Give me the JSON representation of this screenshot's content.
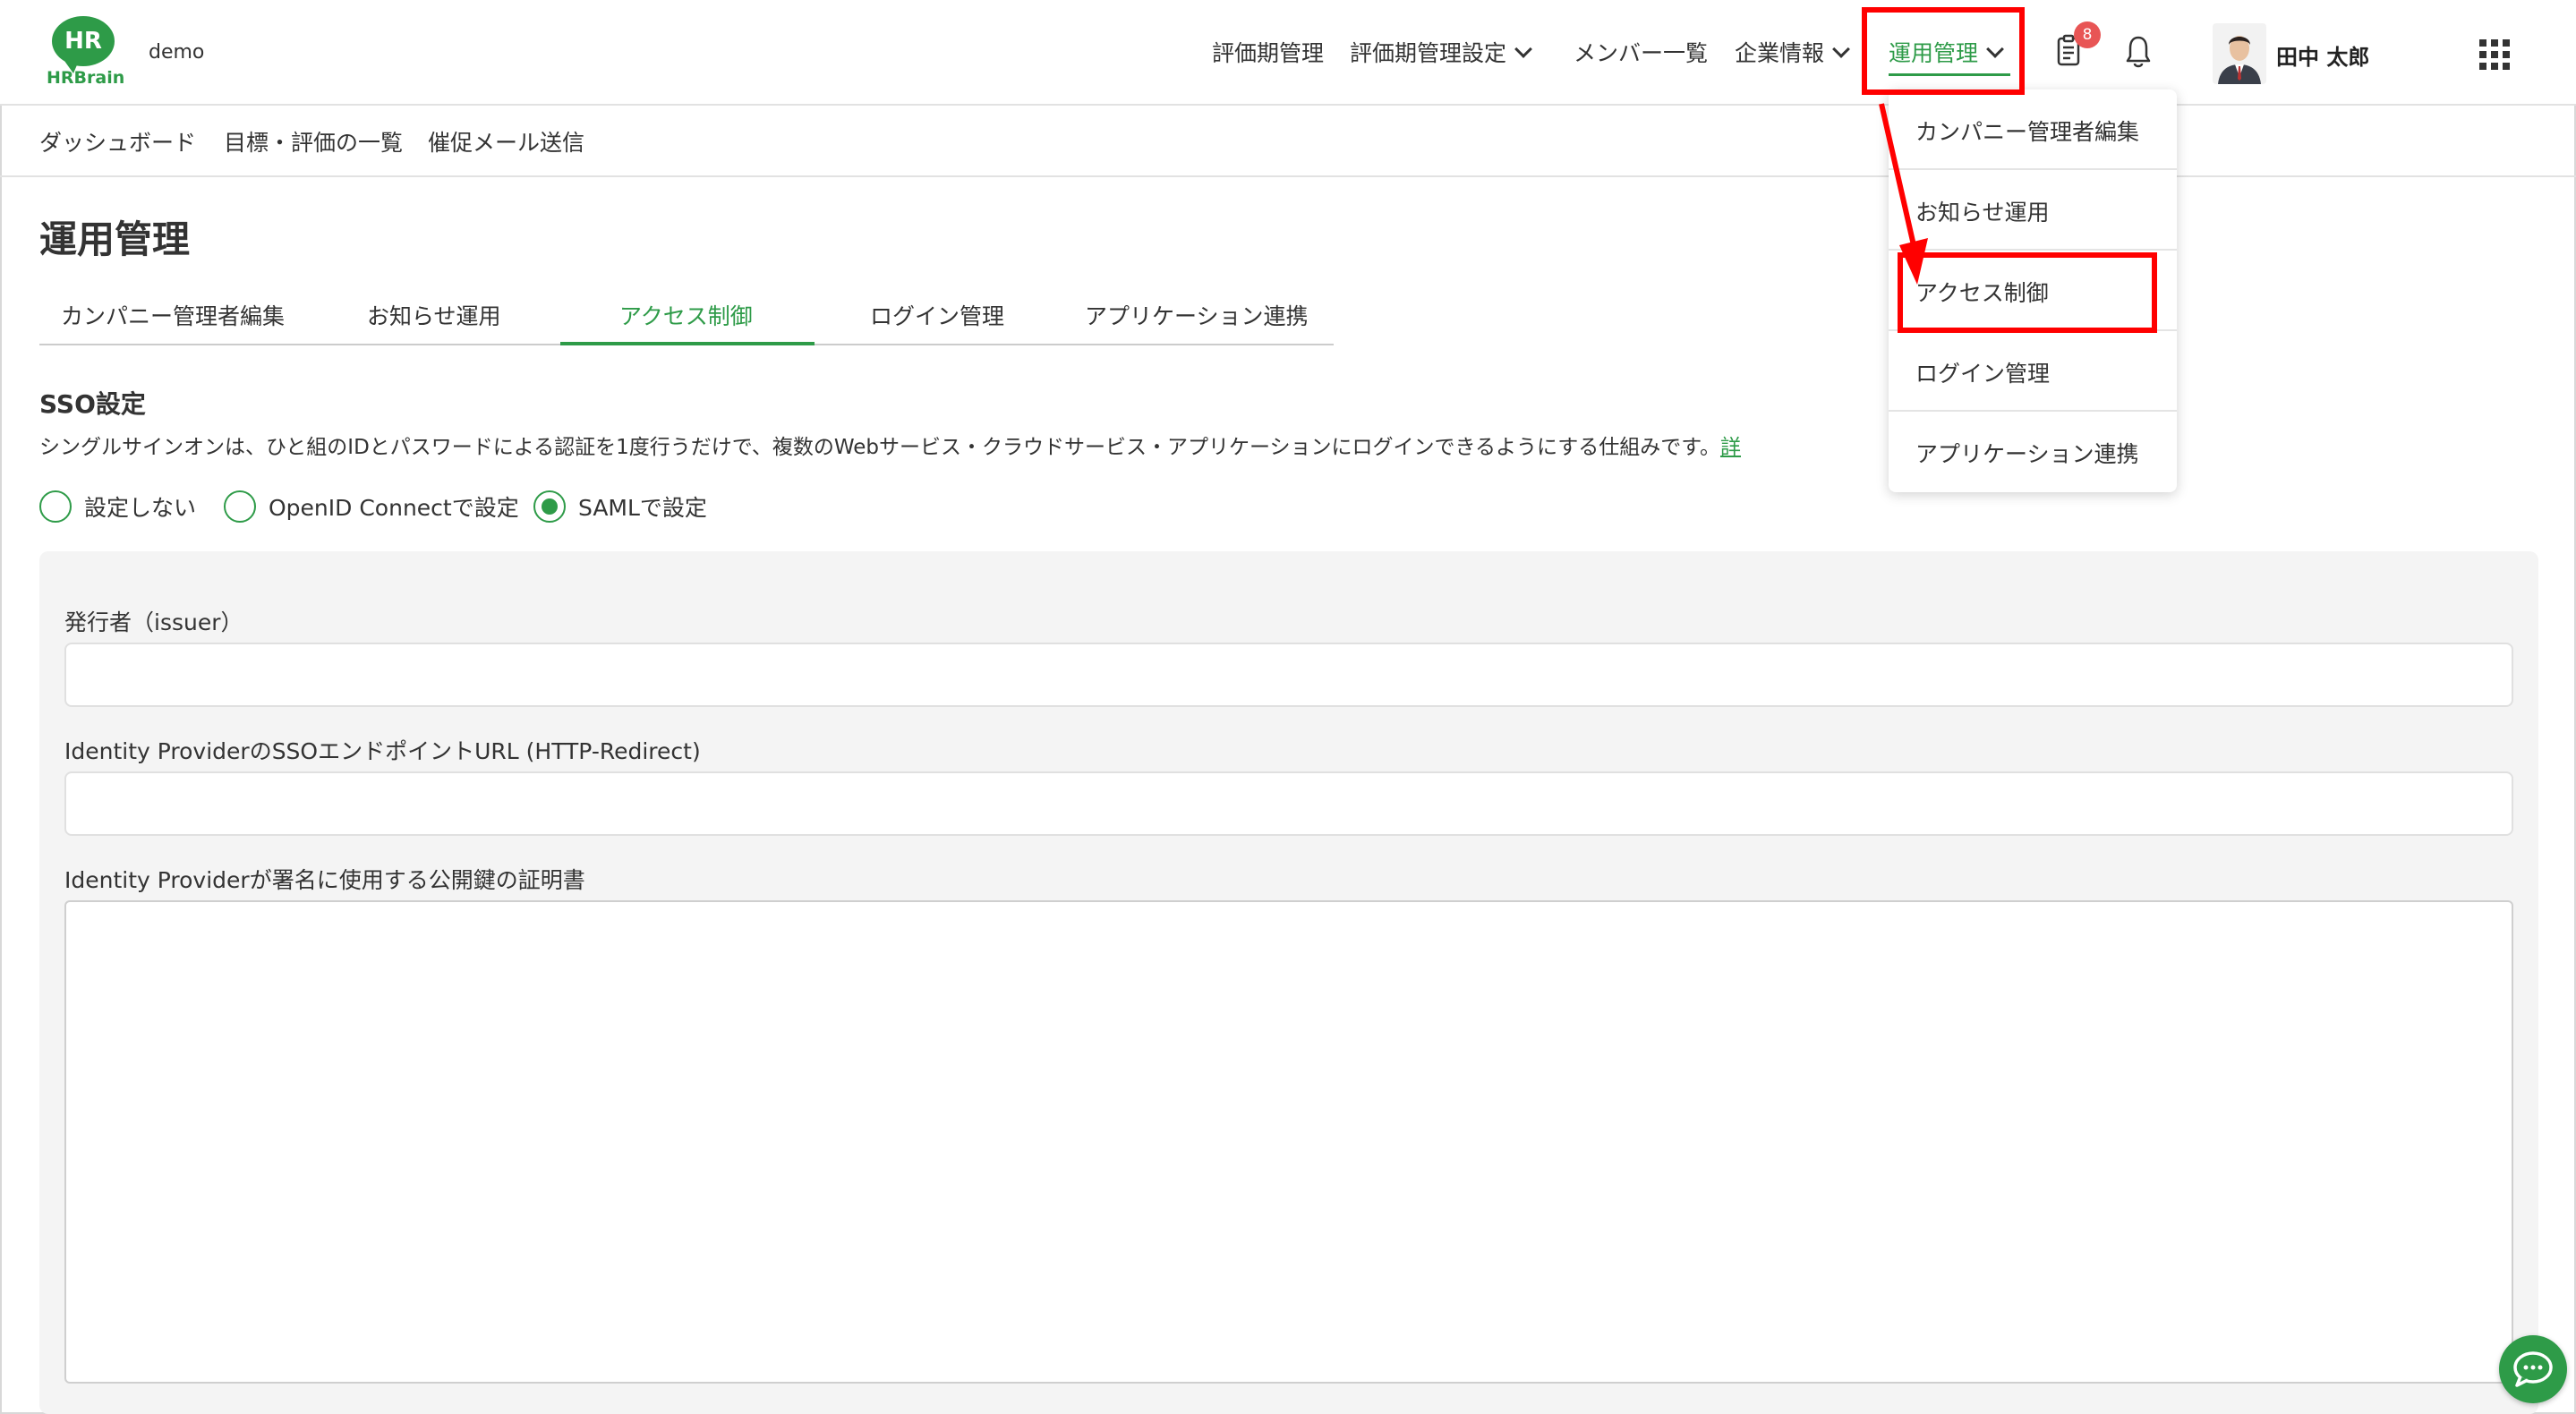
{
  "header": {
    "logo_text": "HR",
    "logo_brand": "HRBrain",
    "tenant": "demo",
    "nav": [
      {
        "label": "評価期管理"
      },
      {
        "label": "評価期管理設定"
      },
      {
        "label": "メンバー一覧"
      },
      {
        "label": "企業情報"
      },
      {
        "label": "運用管理"
      }
    ],
    "notification_count": "8",
    "user_name": "田中 太郎"
  },
  "subnav": {
    "items": [
      "ダッシュボード",
      "目標・評価の一覧",
      "催促メール送信"
    ]
  },
  "page": {
    "title": "運用管理",
    "tabs": [
      "カンパニー管理者編集",
      "お知らせ運用",
      "アクセス制御",
      "ログイン管理",
      "アプリケーション連携"
    ],
    "active_tab": "アクセス制御"
  },
  "sso": {
    "title": "SSO設定",
    "description": "シングルサインオンは、ひと組のIDとパスワードによる認証を1度行うだけで、複数のWebサービス・クラウドサービス・アプリケーションにログインできるようにする仕組みです。",
    "link_text": "詳",
    "options": [
      "設定しない",
      "OpenID Connectで設定",
      "SAMLで設定"
    ],
    "selected": "SAMLで設定",
    "fields": {
      "issuer_label": "発行者（issuer）",
      "issuer_value": "",
      "sso_url_label": "Identity ProviderのSSOエンドポイントURL (HTTP-Redirect)",
      "sso_url_value": "",
      "cert_label": "Identity Providerが署名に使用する公開鍵の証明書",
      "cert_value": ""
    }
  },
  "dropdown": {
    "items": [
      "カンパニー管理者編集",
      "お知らせ運用",
      "アクセス制御",
      "ログイン管理",
      "アプリケーション連携"
    ]
  },
  "colors": {
    "accent": "#2e9b48",
    "highlight": "#ff0000",
    "badge": "#e85555"
  }
}
